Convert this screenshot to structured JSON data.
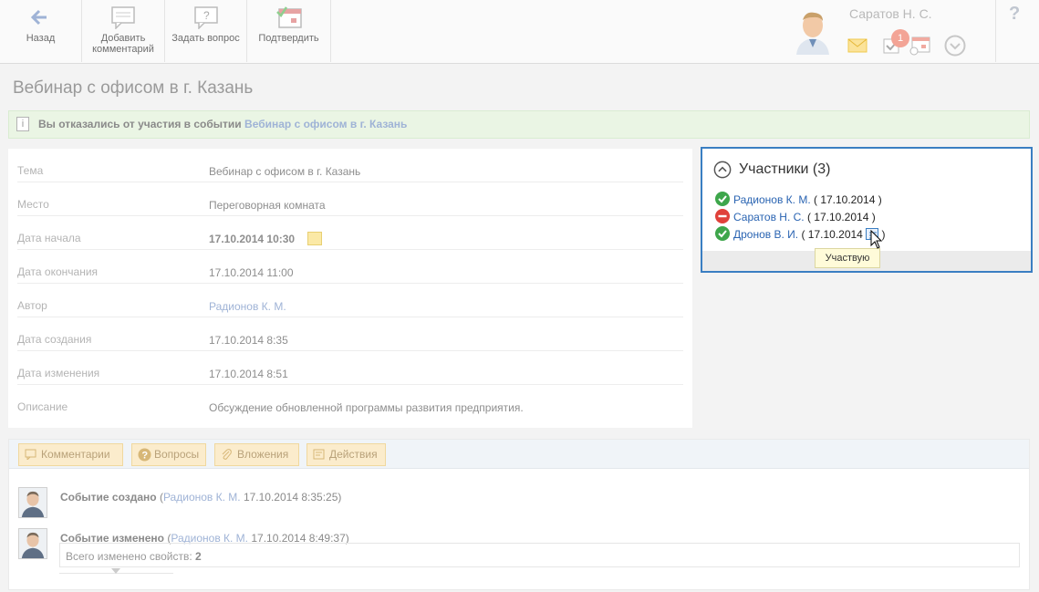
{
  "toolbar": {
    "back_label": "Назад",
    "add_comment_label_1": "Добавить",
    "add_comment_label_2": "комментарий",
    "ask_question_label": "Задать вопрос",
    "confirm_label": "Подтвердить"
  },
  "header": {
    "user_name": "Саратов Н. С.",
    "task_badge": "1",
    "help_label": "?"
  },
  "page": {
    "title": "Вебинар с офисом в г. Казань"
  },
  "notice": {
    "text": "Вы отказались от участия в событии",
    "link": "Вебинар с офисом в г. Казань",
    "icon": "info-icon"
  },
  "details": [
    {
      "label": "Тема",
      "value": "Вебинар с офисом в г. Казань"
    },
    {
      "label": "Место",
      "value": "Переговорная комната"
    },
    {
      "label": "Дата начала",
      "value": "17.10.2014 10:30"
    },
    {
      "label": "Дата окончания",
      "value": "17.10.2014 11:00"
    },
    {
      "label": "Автор",
      "value": "Радионов К. М."
    },
    {
      "label": "Дата создания",
      "value": "17.10.2014 8:35"
    },
    {
      "label": "Дата изменения",
      "value": "17.10.2014 8:51"
    },
    {
      "label": "Описание",
      "value": "Обсуждение обновленной программы развития предприятия."
    }
  ],
  "participants": {
    "title": "Участники (3)",
    "items": [
      {
        "name": "Радионов К. М.",
        "date": " ( 17.10.2014 )",
        "status": "accepted"
      },
      {
        "name": "Саратов Н. С.",
        "date": " ( 17.10.2014 )",
        "status": "declined"
      },
      {
        "name": "Дронов В. И.",
        "date": " ( 17.10.2014 ",
        "close": " )",
        "status": "accepted"
      }
    ],
    "tooltip": "Участвую"
  },
  "tabs": {
    "comments": "Комментарии",
    "questions": "Вопросы",
    "attachments": "Вложения",
    "actions": "Действия"
  },
  "feed": [
    {
      "title": "Событие создано",
      "open": " (",
      "author": "Радионов К. М.",
      "time": " 17.10.2014 8:35:25)"
    },
    {
      "title": "Событие изменено",
      "open": " (",
      "author": "Радионов К. М.",
      "time": " 17.10.2014 8:49:37)"
    }
  ],
  "changes": {
    "label": "Всего изменено свойств: ",
    "count": "2"
  },
  "colors": {
    "accent": "#3a7ec2",
    "accepted": "#3ea64b",
    "declined": "#e0413a",
    "link": "#2a64b2"
  }
}
